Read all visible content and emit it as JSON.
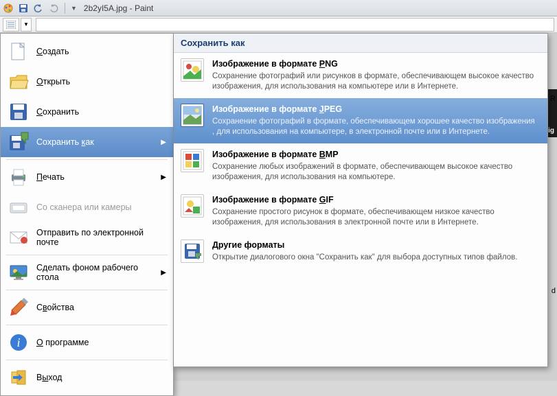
{
  "titlebar": {
    "filename": "2b2yI5A.jpg",
    "appname": "Paint"
  },
  "file_menu": {
    "items": [
      {
        "label": "Создать",
        "ul_index": 0,
        "icon": "new",
        "disabled": false,
        "arrow": false
      },
      {
        "label": "Открыть",
        "ul_index": 0,
        "icon": "open",
        "disabled": false,
        "arrow": false
      },
      {
        "label": "Сохранить",
        "ul_index": 0,
        "icon": "save",
        "disabled": false,
        "arrow": false
      },
      {
        "label": "Сохранить как",
        "ul_index": 10,
        "icon": "saveas",
        "disabled": false,
        "arrow": true,
        "highlight": true
      },
      {
        "sep": true
      },
      {
        "label": "Печать",
        "ul_index": 0,
        "icon": "print",
        "disabled": false,
        "arrow": true
      },
      {
        "label": "Со сканера или камеры",
        "ul_index": -1,
        "icon": "scanner",
        "disabled": true,
        "arrow": false
      },
      {
        "label": "Отправить по электронной почте",
        "ul_index": -1,
        "icon": "mail",
        "disabled": false,
        "arrow": false
      },
      {
        "sep": true
      },
      {
        "label": "Сделать фоном рабочего стола",
        "ul_index": -1,
        "icon": "desktop",
        "disabled": false,
        "arrow": true
      },
      {
        "sep": true
      },
      {
        "label": "Свойства",
        "ul_index": 1,
        "icon": "props",
        "disabled": false,
        "arrow": false
      },
      {
        "sep": true
      },
      {
        "label": "О программе",
        "ul_index": 0,
        "icon": "about",
        "disabled": false,
        "arrow": false
      },
      {
        "sep": true
      },
      {
        "label": "Выход",
        "ul_index": 1,
        "icon": "exit",
        "disabled": false,
        "arrow": false
      }
    ]
  },
  "submenu": {
    "header": "Сохранить как",
    "items": [
      {
        "title": "Изображение в формате PNG",
        "ul_index": 22,
        "desc": "Сохранение фотографий или рисунков в формате, обеспечивающем высокое качество изображения, для использования на компьютере или в Интернете.",
        "icon": "png",
        "selected": false
      },
      {
        "title": "Изображение в формате JPEG",
        "ul_index": 22,
        "desc": "Сохранение фотографий в формате, обеспечивающем хорошее качество изображения , для использования на компьютере, в электронной почте или в Интернете.",
        "icon": "jpeg",
        "selected": true
      },
      {
        "title": "Изображение в формате BMP",
        "ul_index": 22,
        "desc": "Сохранение любых изображений в формате, обеспечивающем высокое качество изображения, для использования на компьютере.",
        "icon": "bmp",
        "selected": false
      },
      {
        "title": "Изображение в формате GIF",
        "ul_index": 22,
        "desc": "Сохранение простого рисунок в формате, обеспечивающем низкое качество изображения, для использования в электронной почте или в Интернете.",
        "icon": "gif",
        "selected": false
      },
      {
        "title": "Другие форматы",
        "ul_index": 0,
        "desc": "Открытие диалогового окна \"Сохранить как\" для выбора доступных типов файлов.",
        "icon": "other",
        "selected": false
      }
    ]
  },
  "workspace": {
    "right_marker": "ig",
    "right_hint_r": "R",
    "right_hint_d": "d"
  }
}
